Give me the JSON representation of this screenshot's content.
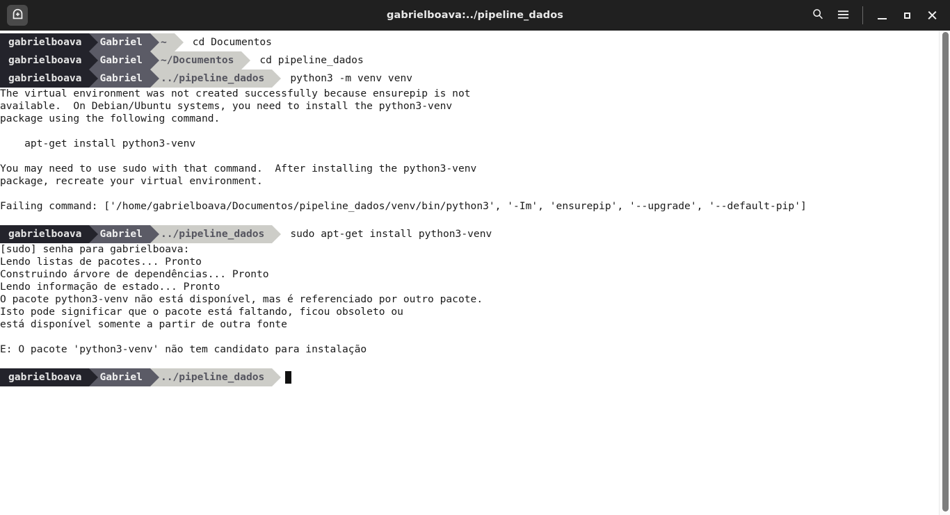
{
  "window": {
    "title": "gabrielboava:../pipeline_dados",
    "newtab_icon": "new-terminal-icon",
    "search_icon": "search-icon",
    "menu_icon": "hamburger-menu-icon",
    "minimize_label": "minimize",
    "maximize_label": "maximize",
    "close_label": "close"
  },
  "theme": {
    "titlebar_bg": "#202020",
    "terminal_bg": "#ffffff",
    "terminal_fg": "#1a1a1a",
    "prompt_user_bg": "#23232b",
    "prompt_host_bg": "#5b5b66",
    "prompt_path_bg": "#cdcdc8",
    "prompt_path_fg": "#55555f",
    "scrollbar_thumb": "#7d7d7d"
  },
  "prompt": {
    "user": "gabrielboava",
    "host": "Gabriel"
  },
  "session": [
    {
      "type": "prompt",
      "path": "~",
      "command": "cd Documentos"
    },
    {
      "type": "prompt",
      "path": "~/Documentos",
      "command": "cd pipeline_dados"
    },
    {
      "type": "prompt",
      "path": "../pipeline_dados",
      "command": "python3 -m venv venv"
    },
    {
      "type": "output",
      "lines": [
        "The virtual environment was not created successfully because ensurepip is not",
        "available.  On Debian/Ubuntu systems, you need to install the python3-venv",
        "package using the following command.",
        "",
        "    apt-get install python3-venv",
        "",
        "You may need to use sudo with that command.  After installing the python3-venv",
        "package, recreate your virtual environment.",
        "",
        "Failing command: ['/home/gabrielboava/Documentos/pipeline_dados/venv/bin/python3', '-Im', 'ensurepip', '--upgrade', '--default-pip']",
        ""
      ]
    },
    {
      "type": "prompt",
      "path": "../pipeline_dados",
      "command": "sudo apt-get install python3-venv"
    },
    {
      "type": "output",
      "lines": [
        "[sudo] senha para gabrielboava:",
        "Lendo listas de pacotes... Pronto",
        "Construindo árvore de dependências... Pronto",
        "Lendo informação de estado... Pronto",
        "O pacote python3-venv não está disponível, mas é referenciado por outro pacote.",
        "Isto pode significar que o pacote está faltando, ficou obsoleto ou",
        "está disponível somente a partir de outra fonte",
        "",
        "E: O pacote 'python3-venv' não tem candidato para instalação",
        ""
      ]
    },
    {
      "type": "prompt",
      "path": "../pipeline_dados",
      "command": "",
      "cursor": true
    }
  ]
}
